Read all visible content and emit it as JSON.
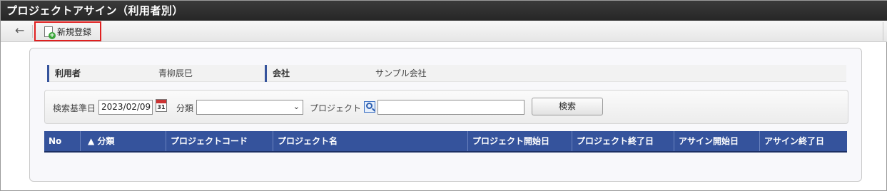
{
  "window": {
    "title": "プロジェクトアサイン（利用者別）"
  },
  "toolbar": {
    "back_icon": "←",
    "new_label": "新規登録"
  },
  "info": {
    "user_label": "利用者",
    "user_value": "青柳辰巳",
    "company_label": "会社",
    "company_value": "サンプル会社"
  },
  "search": {
    "date_label": "検索基準日",
    "date_value": "2023/02/09",
    "calendar_day": "31",
    "category_label": "分類",
    "category_value": "",
    "project_label": "プロジェクト",
    "project_value": "",
    "search_button": "検索"
  },
  "grid": {
    "columns": [
      "No",
      "▲ 分類",
      "プロジェクトコード",
      "プロジェクト名",
      "プロジェクト開始日",
      "プロジェクト終了日",
      "アサイン開始日",
      "アサイン終了日"
    ],
    "header_color": "#35539c"
  }
}
